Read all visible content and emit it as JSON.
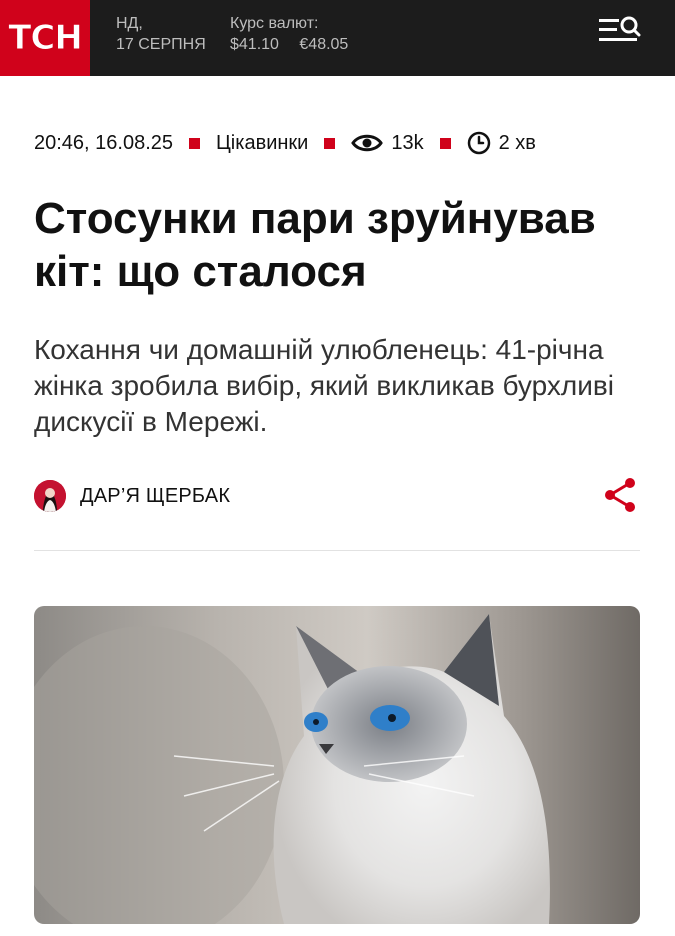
{
  "header": {
    "logo": "ТСН",
    "day": "НД,",
    "date": "17 СЕРПНЯ",
    "rates_label": "Курс валют:",
    "usd_rate": "$41.10",
    "eur_rate": "€48.05",
    "menu_icon": "menu-search-icon"
  },
  "meta": {
    "published": "20:46, 16.08.25",
    "category": "Цікавинки",
    "views": "13k",
    "read_time": "2 хв"
  },
  "article": {
    "title": "Стосунки пари зруйнував кіт: що сталося",
    "lead": "Кохання чи домашній улюбленець: 41-річна жінка зробила вибір, який викликав бурхливі дискусії в Мережі.",
    "author": "ДАР’Я ЩЕРБАК"
  },
  "colors": {
    "brand_red": "#d0021b",
    "header_bg": "#1c1c1c"
  }
}
